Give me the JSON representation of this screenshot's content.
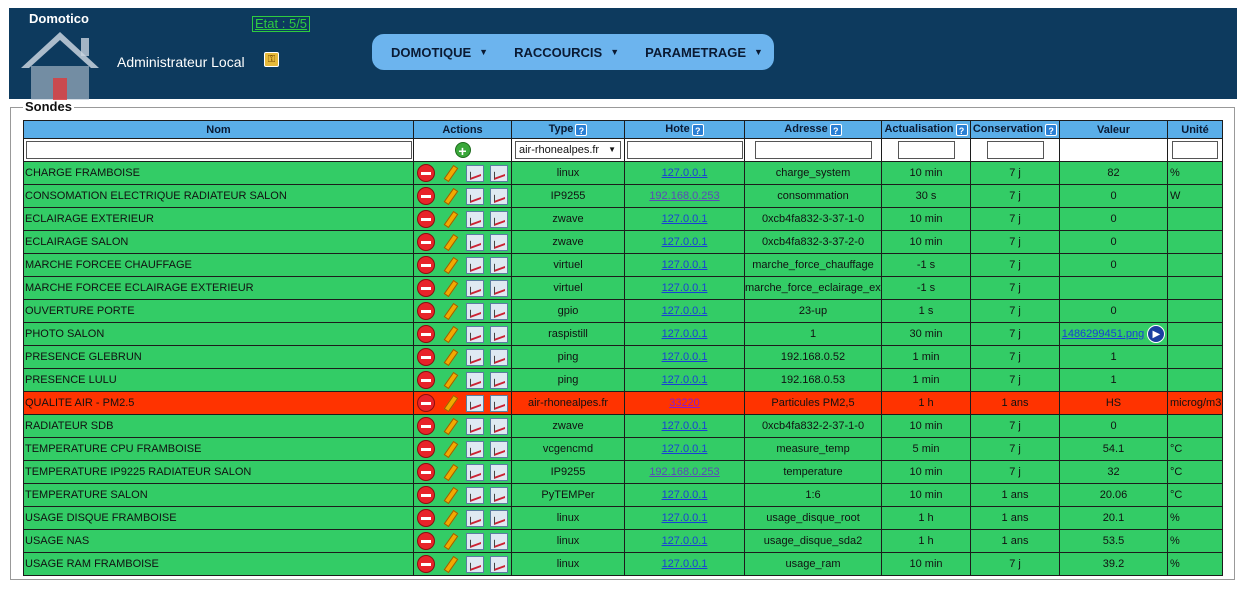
{
  "header": {
    "brand": "Domotico",
    "etat": "Etat : 5/5",
    "admin": "Administrateur Local",
    "nav": [
      {
        "label": "DOMOTIQUE"
      },
      {
        "label": "RACCOURCIS"
      },
      {
        "label": "PARAMETRAGE"
      }
    ]
  },
  "panel": {
    "legend": "Sondes"
  },
  "table": {
    "columns": {
      "nom": "Nom",
      "actions": "Actions",
      "type": "Type",
      "hote": "Hote",
      "adresse": "Adresse",
      "actualisation": "Actualisation",
      "conservation": "Conservation",
      "valeur": "Valeur",
      "unite": "Unité"
    },
    "filter": {
      "type_selected": "air-rhonealpes.fr"
    },
    "rows": [
      {
        "nom": "CHARGE FRAMBOISE",
        "type": "linux",
        "hote": "127.0.0.1",
        "adresse": "charge_system",
        "actualisation": "10 min",
        "conservation": "7 j",
        "valeur": "82",
        "unite": "%",
        "status": "ok"
      },
      {
        "nom": "CONSOMATION ELECTRIQUE RADIATEUR SALON",
        "type": "IP9255",
        "hote": "192.168.0.253",
        "adresse": "consommation",
        "actualisation": "30 s",
        "conservation": "7 j",
        "valeur": "0",
        "unite": "W",
        "status": "ok"
      },
      {
        "nom": "ECLAIRAGE EXTERIEUR",
        "type": "zwave",
        "hote": "127.0.0.1",
        "adresse": "0xcb4fa832-3-37-1-0",
        "actualisation": "10 min",
        "conservation": "7 j",
        "valeur": "0",
        "unite": "",
        "status": "ok"
      },
      {
        "nom": "ECLAIRAGE SALON",
        "type": "zwave",
        "hote": "127.0.0.1",
        "adresse": "0xcb4fa832-3-37-2-0",
        "actualisation": "10 min",
        "conservation": "7 j",
        "valeur": "0",
        "unite": "",
        "status": "ok"
      },
      {
        "nom": "MARCHE FORCEE CHAUFFAGE",
        "type": "virtuel",
        "hote": "127.0.0.1",
        "adresse": "marche_force_chauffage",
        "actualisation": "-1 s",
        "conservation": "7 j",
        "valeur": "0",
        "unite": "",
        "status": "ok"
      },
      {
        "nom": "MARCHE FORCEE ECLAIRAGE EXTERIEUR",
        "type": "virtuel",
        "hote": "127.0.0.1",
        "adresse": "marche_force_eclairage_ext",
        "actualisation": "-1 s",
        "conservation": "7 j",
        "valeur": "",
        "unite": "",
        "status": "ok"
      },
      {
        "nom": "OUVERTURE PORTE",
        "type": "gpio",
        "hote": "127.0.0.1",
        "adresse": "23-up",
        "actualisation": "1 s",
        "conservation": "7 j",
        "valeur": "0",
        "unite": "",
        "status": "ok"
      },
      {
        "nom": "PHOTO SALON",
        "type": "raspistill",
        "hote": "127.0.0.1",
        "adresse": "1",
        "actualisation": "30 min",
        "conservation": "7 j",
        "valeur": "1486299451.png",
        "unite": "",
        "status": "ok",
        "play": true
      },
      {
        "nom": "PRESENCE GLEBRUN",
        "type": "ping",
        "hote": "127.0.0.1",
        "adresse": "192.168.0.52",
        "actualisation": "1 min",
        "conservation": "7 j",
        "valeur": "1",
        "unite": "",
        "status": "ok"
      },
      {
        "nom": "PRESENCE LULU",
        "type": "ping",
        "hote": "127.0.0.1",
        "adresse": "192.168.0.53",
        "actualisation": "1 min",
        "conservation": "7 j",
        "valeur": "1",
        "unite": "",
        "status": "ok"
      },
      {
        "nom": "QUALITE AIR - PM2.5",
        "type": "air-rhonealpes.fr",
        "hote": "33220",
        "adresse": "Particules PM2,5",
        "actualisation": "1 h",
        "conservation": "1 ans",
        "valeur": "HS",
        "unite": "microg/m3",
        "status": "err"
      },
      {
        "nom": "RADIATEUR SDB",
        "type": "zwave",
        "hote": "127.0.0.1",
        "adresse": "0xcb4fa832-2-37-1-0",
        "actualisation": "10 min",
        "conservation": "7 j",
        "valeur": "0",
        "unite": "",
        "status": "ok"
      },
      {
        "nom": "TEMPERATURE CPU FRAMBOISE",
        "type": "vcgencmd",
        "hote": "127.0.0.1",
        "adresse": "measure_temp",
        "actualisation": "5 min",
        "conservation": "7 j",
        "valeur": "54.1",
        "unite": "°C",
        "status": "ok"
      },
      {
        "nom": "TEMPERATURE IP9225 RADIATEUR SALON",
        "type": "IP9255",
        "hote": "192.168.0.253",
        "adresse": "temperature",
        "actualisation": "10 min",
        "conservation": "7 j",
        "valeur": "32",
        "unite": "°C",
        "status": "ok"
      },
      {
        "nom": "TEMPERATURE SALON",
        "type": "PyTEMPer",
        "hote": "127.0.0.1",
        "adresse": "1:6",
        "actualisation": "10 min",
        "conservation": "1 ans",
        "valeur": "20.06",
        "unite": "°C",
        "status": "ok"
      },
      {
        "nom": "USAGE DISQUE FRAMBOISE",
        "type": "linux",
        "hote": "127.0.0.1",
        "adresse": "usage_disque_root",
        "actualisation": "1 h",
        "conservation": "1 ans",
        "valeur": "20.1",
        "unite": "%",
        "status": "ok"
      },
      {
        "nom": "USAGE NAS",
        "type": "linux",
        "hote": "127.0.0.1",
        "adresse": "usage_disque_sda2",
        "actualisation": "1 h",
        "conservation": "1 ans",
        "valeur": "53.5",
        "unite": "%",
        "status": "ok"
      },
      {
        "nom": "USAGE RAM FRAMBOISE",
        "type": "linux",
        "hote": "127.0.0.1",
        "adresse": "usage_ram",
        "actualisation": "10 min",
        "conservation": "7 j",
        "valeur": "39.2",
        "unite": "%",
        "status": "ok"
      }
    ]
  },
  "colors": {
    "ok_row": "#33cc66",
    "error_row": "#ff3300",
    "header_bg": "#0d3a5e",
    "nav_bg": "#6cb4ee",
    "column_header": "#5aaee8"
  },
  "icons": {
    "delete": "delete-icon",
    "edit": "edit-icon",
    "chart": "chart-icon",
    "add": "add-icon",
    "help": "help-icon",
    "play": "play-icon",
    "key": "key-icon"
  }
}
